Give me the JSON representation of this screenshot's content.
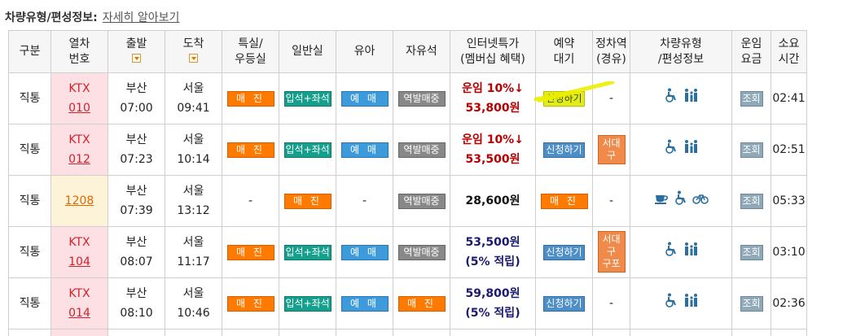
{
  "header": {
    "title": "차량유형/편성정보:",
    "link": "자세히 알아보기"
  },
  "columns": {
    "type": "구분",
    "train": [
      "열차",
      "번호"
    ],
    "dep": "출발",
    "arr": "도착",
    "special": [
      "특실/",
      "우등실"
    ],
    "general": "일반실",
    "infant": "유아",
    "free": "자유석",
    "internet": [
      "인터넷특가",
      "(멤버십 혜택)"
    ],
    "waitlist": [
      "예약",
      "대기"
    ],
    "stop": [
      "정차역",
      "(경유)"
    ],
    "vehicle": [
      "차량유형",
      "/편성정보"
    ],
    "fare": [
      "운임",
      "요금"
    ],
    "duration": [
      "소요",
      "시간"
    ]
  },
  "rows": [
    {
      "type": "직통",
      "train_type": "KTX",
      "train_no": "010",
      "dep_station": "부산",
      "dep_time": "07:00",
      "arr_station": "서울",
      "arr_time": "09:41",
      "special": "매 진",
      "general": "입석+좌석",
      "infant": "예 매",
      "free": "역발매중",
      "price_line1": "운임 10%↓",
      "price_line2": "53,800원",
      "waitlist": "신청하기",
      "stop": "-",
      "fare": "조회",
      "duration": "02:41"
    },
    {
      "type": "직통",
      "train_type": "KTX",
      "train_no": "012",
      "dep_station": "부산",
      "dep_time": "07:23",
      "arr_station": "서울",
      "arr_time": "10:14",
      "special": "매 진",
      "general": "입석+좌석",
      "infant": "예 매",
      "free": "역발매중",
      "price_line1": "운임 10%↓",
      "price_line2": "53,500원",
      "waitlist": "신청하기",
      "stop": "서대구",
      "fare": "조회",
      "duration": "02:51"
    },
    {
      "type": "직통",
      "train_no": "1208",
      "dep_station": "부산",
      "dep_time": "07:39",
      "arr_station": "서울",
      "arr_time": "13:12",
      "special": "-",
      "general": "매 진",
      "infant": "-",
      "free": "역발매중",
      "price_line1": "28,600원",
      "waitlist": "매 진",
      "stop": "-",
      "fare": "조회",
      "duration": "05:33"
    },
    {
      "type": "직통",
      "train_type": "KTX",
      "train_no": "104",
      "dep_station": "부산",
      "dep_time": "08:07",
      "arr_station": "서울",
      "arr_time": "11:17",
      "special": "매 진",
      "general": "입석+좌석",
      "infant": "예 매",
      "free": "역발매중",
      "price_line1": "53,500원",
      "price_line2": "(5% 적립)",
      "waitlist": "신청하기",
      "stop": [
        "서대구",
        "구포"
      ],
      "fare": "조회",
      "duration": "03:10"
    },
    {
      "type": "직통",
      "train_type": "KTX",
      "train_no": "014",
      "dep_station": "부산",
      "dep_time": "08:10",
      "arr_station": "서울",
      "arr_time": "10:46",
      "special": "매 진",
      "general": "입석+좌석",
      "infant": "예 매",
      "free": "매 진",
      "price_line1": "59,800원",
      "price_line2": "(5% 적립)",
      "waitlist": "신청하기",
      "stop": "-",
      "fare": "조회",
      "duration": "02:36"
    }
  ],
  "icons": {
    "ktx_vehicle": [
      "wheelchair-icon",
      "family-icon"
    ],
    "mugunghwa_vehicle": [
      "cafe-icon",
      "wheelchair-icon",
      "bicycle-icon"
    ]
  },
  "colors": {
    "soldout": "#ff7a00",
    "seat": "#15a08e",
    "reserve": "#3d9bdc",
    "station_sale": "#888888",
    "apply": "#4d8ec6",
    "highlight": "#e2ec1a",
    "ktx_bg": "#fde0e4",
    "price_red": "#b80000",
    "price_blue": "#1a1a6e"
  }
}
